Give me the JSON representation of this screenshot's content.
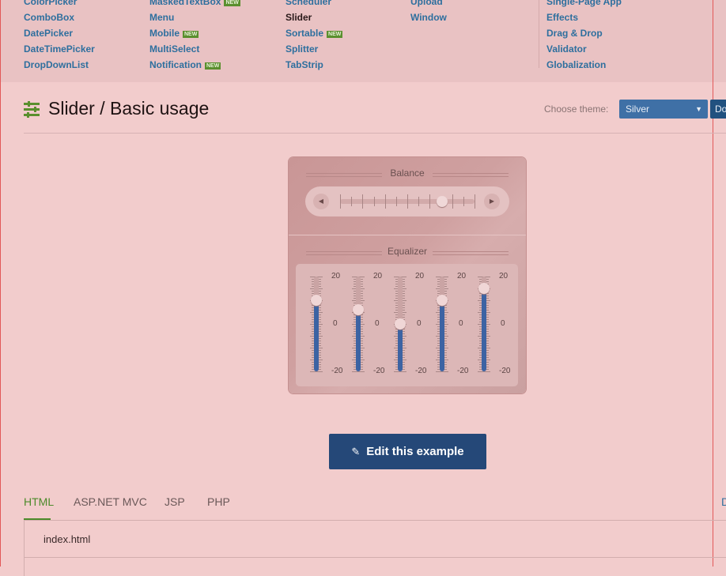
{
  "nav": {
    "col1": [
      "ColorPicker",
      "ComboBox",
      "DatePicker",
      "DateTimePicker",
      "DropDownList"
    ],
    "col2": [
      "MaskedTextBox",
      "Menu",
      "Mobile",
      "MultiSelect",
      "Notification"
    ],
    "col3": [
      "Scheduler",
      "Slider",
      "Sortable",
      "Splitter",
      "TabStrip"
    ],
    "col4": [
      "Upload",
      "Window"
    ],
    "col5": [
      "Single-Page App",
      "Effects",
      "Drag & Drop",
      "Validator",
      "Globalization"
    ],
    "new_badge": "NEW"
  },
  "header": {
    "title": "Slider / Basic usage",
    "theme_label": "Choose theme:",
    "theme_value": "Silver",
    "theme_button": "Do"
  },
  "balance": {
    "title": "Balance",
    "value_fraction": 0.76
  },
  "equalizer": {
    "title": "Equalizer",
    "max_label": "20",
    "mid_label": "0",
    "min_label": "-20",
    "bands": [
      10,
      6,
      0,
      10,
      15
    ]
  },
  "edit_button": "Edit this example",
  "tabs": [
    "HTML",
    "ASP.NET MVC",
    "JSP",
    "PHP"
  ],
  "right_tab": "D",
  "file_name": "index.html",
  "colors": {
    "accent_blue": "#254878",
    "fill_blue": "#3c63a3",
    "link_blue": "#2e6f9e",
    "green": "#4c8a2a"
  }
}
